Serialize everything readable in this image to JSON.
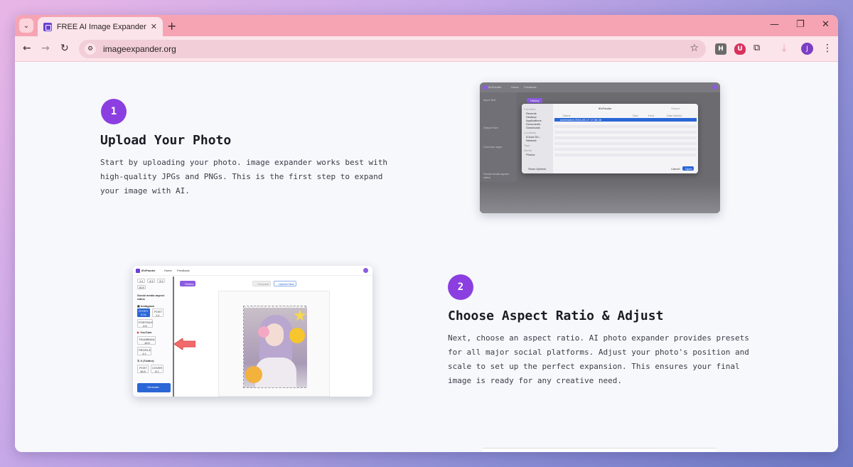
{
  "browser": {
    "tab_title": "FREE AI Image Expander Online",
    "url": "imageexpander.org",
    "profile_initial": "J",
    "extensions": [
      "H",
      "U"
    ]
  },
  "steps": [
    {
      "number": "1",
      "title": "Upload Your Photo",
      "text_lines": [
        "Start by uploading your photo. image expander works best with",
        "high-quality JPGs and PNGs. This is the first step to expand",
        "your image with AI."
      ]
    },
    {
      "number": "2",
      "title": "Choose Aspect Ratio & Adjust",
      "text_lines": [
        "Next, choose an aspect ratio. AI photo expander provides presets",
        "for all major social platforms. Adjust your photo's position and",
        "scale to set up the perfect expansion. This ensures your final",
        "image is ready for any creative need."
      ]
    }
  ],
  "screenshot1": {
    "app_name": "iExPander",
    "nav": [
      "Home",
      "Feedback"
    ],
    "sidebar_labels": [
      "Input Text",
      "Output Size",
      "Common aspe",
      "Social media aspect ratios",
      "Instagram"
    ],
    "history_label": "History",
    "dialog_sidebar": [
      "Favorites",
      "Recents",
      "Desktop",
      "Applications",
      "Documents",
      "Downloads",
      "Locations",
      "iCloud Dri...",
      "Network",
      "Tags",
      "Media",
      "Photos"
    ],
    "dialog_folder": "iExPander",
    "dialog_search": "Search",
    "dialog_columns": [
      "Name",
      "Size",
      "Kind",
      "Date Added"
    ],
    "dialog_selected_file": "screenshot 2024-09-17 17.36.08",
    "dialog_options": "Show Options",
    "dialog_cancel": "Cancel",
    "dialog_open": "Open"
  },
  "screenshot2": {
    "app_name": "iExPander",
    "nav": [
      "Home",
      "Feedback"
    ],
    "ratio_buttons_top": [
      "1:1",
      "4:3",
      "3:2",
      "16:9"
    ],
    "social_heading": "Social media aspect ratios",
    "instagram": "Instagram",
    "instagram_options": [
      {
        "label": "STORY",
        "ratio": "9:16"
      },
      {
        "label": "POST",
        "ratio": "1:1"
      },
      {
        "label": "PORTRAIT",
        "ratio": "4:5"
      }
    ],
    "youtube": "YouTube",
    "youtube_options": [
      {
        "label": "THUMBNAIL",
        "ratio": "16:9"
      },
      {
        "label": "PROFILE",
        "ratio": "1:1"
      }
    ],
    "x_label": "X (Twitter)",
    "x_options": [
      {
        "label": "POST",
        "ratio": "16:9"
      },
      {
        "label": "COVER",
        "ratio": "3:1"
      }
    ],
    "generate": "Generate",
    "history_label": "History",
    "compare_label": "Compare",
    "upload_label": "Upload New"
  },
  "colors": {
    "accent": "#8b3fe0",
    "tab_strip": "#f6a4b4",
    "toolbar": "#fbe4ea",
    "page_bg": "#f7f8fc"
  }
}
